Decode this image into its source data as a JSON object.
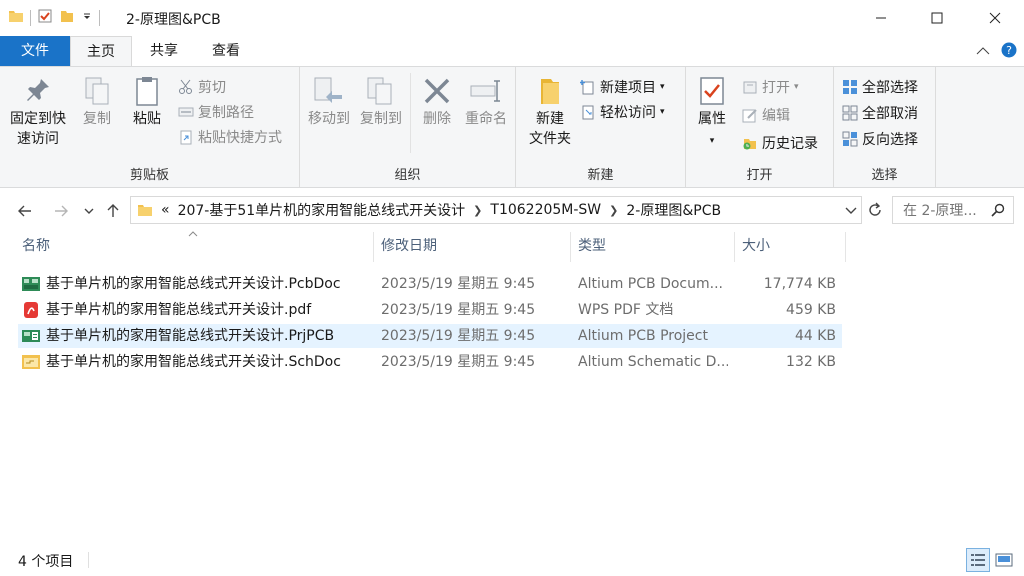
{
  "window": {
    "title": "2-原理图&PCB"
  },
  "ribbon_tabs": [
    "文件",
    "主页",
    "共享",
    "查看"
  ],
  "ribbon": {
    "clipboard": {
      "label": "剪贴板",
      "pin": "固定到快速访问",
      "pin_line1": "固定到快",
      "pin_line2": "速访问",
      "copy": "复制",
      "paste": "粘贴",
      "cut": "剪切",
      "copy_path": "复制路径",
      "paste_shortcut": "粘贴快捷方式"
    },
    "organize": {
      "label": "组织",
      "move_to": "移动到",
      "copy_to": "复制到",
      "delete": "删除",
      "rename": "重命名"
    },
    "new": {
      "label": "新建",
      "new_folder_line1": "新建",
      "new_folder_line2": "文件夹",
      "new_item": "新建项目",
      "easy_access": "轻松访问"
    },
    "open": {
      "label": "打开",
      "properties": "属性",
      "open": "打开",
      "edit": "编辑",
      "history": "历史记录"
    },
    "select": {
      "label": "选择",
      "select_all": "全部选择",
      "select_none": "全部取消",
      "invert": "反向选择"
    }
  },
  "address": {
    "overflow": "«",
    "crumbs": [
      "207-基于51单片机的家用智能总线式开关设计",
      "T1062205M-SW",
      "2-原理图&PCB"
    ]
  },
  "search": {
    "placeholder": "在 2-原理..."
  },
  "columns": {
    "name": "名称",
    "date": "修改日期",
    "type": "类型",
    "size": "大小"
  },
  "files": [
    {
      "name": "基于单片机的家用智能总线式开关设计.PcbDoc",
      "date": "2023/5/19 星期五 9:45",
      "type": "Altium PCB Docum...",
      "size": "17,774 KB",
      "icon": "pcb-doc-icon"
    },
    {
      "name": "基于单片机的家用智能总线式开关设计.pdf",
      "date": "2023/5/19 星期五 9:45",
      "type": "WPS PDF 文档",
      "size": "459 KB",
      "icon": "pdf-icon"
    },
    {
      "name": "基于单片机的家用智能总线式开关设计.PrjPCB",
      "date": "2023/5/19 星期五 9:45",
      "type": "Altium PCB Project",
      "size": "44 KB",
      "icon": "pcb-project-icon"
    },
    {
      "name": "基于单片机的家用智能总线式开关设计.SchDoc",
      "date": "2023/5/19 星期五 9:45",
      "type": "Altium Schematic D...",
      "size": "132 KB",
      "icon": "schematic-doc-icon"
    }
  ],
  "status": {
    "item_count": "4 个项目"
  },
  "colors": {
    "accent": "#1a73c8",
    "selected_row": "#e5f3ff",
    "folder": "#f2c14e"
  }
}
